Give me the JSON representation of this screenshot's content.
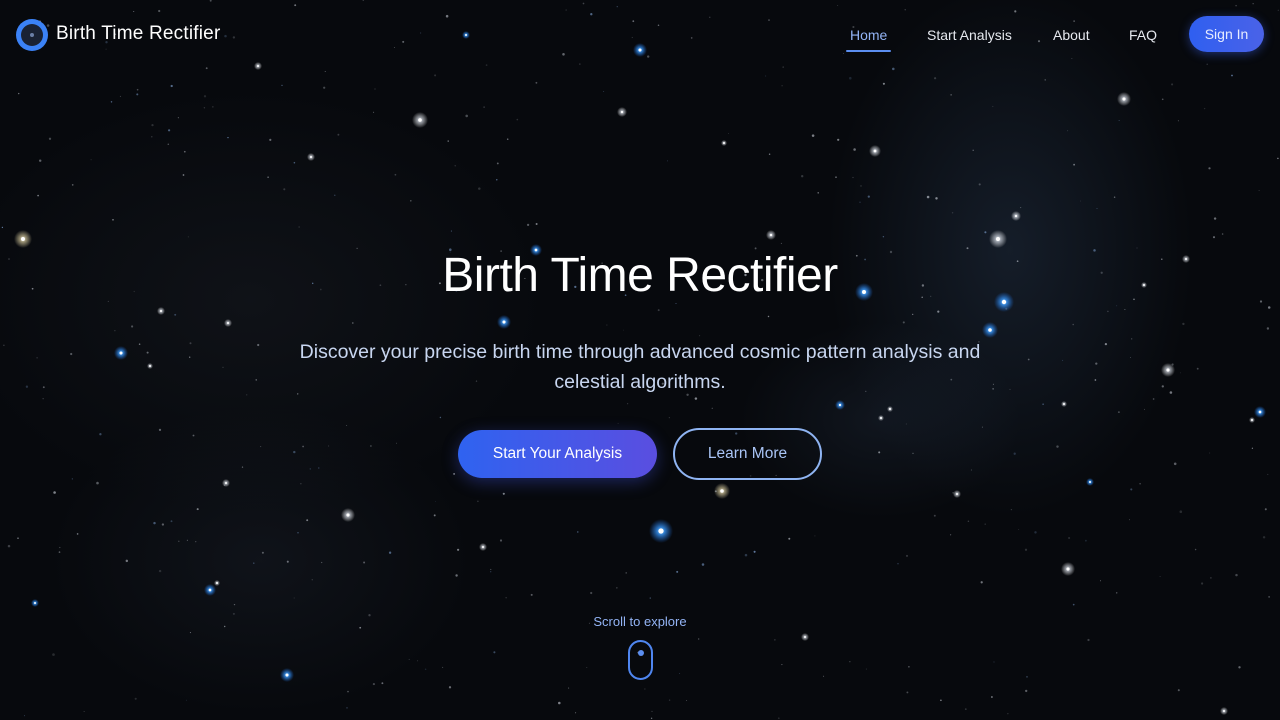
{
  "header": {
    "brand": "Birth Time Rectifier",
    "logo_icon": "orbit-logo-icon",
    "nav": [
      {
        "label": "Home",
        "active": true
      },
      {
        "label": "Start Analysis",
        "active": false
      },
      {
        "label": "About",
        "active": false
      },
      {
        "label": "FAQ",
        "active": false
      }
    ],
    "signin_label": "Sign In"
  },
  "hero": {
    "title": "Birth Time Rectifier",
    "subtitle": "Discover your precise birth time through advanced cosmic pattern analysis and celestial algorithms.",
    "primary_cta": "Start Your Analysis",
    "secondary_cta": "Learn More"
  },
  "scroll": {
    "label": "Scroll to explore",
    "icon": "mouse-scroll-icon"
  },
  "colors": {
    "accent": "#3b82f6",
    "accent_light": "#93b4f5",
    "background": "#07090d"
  }
}
